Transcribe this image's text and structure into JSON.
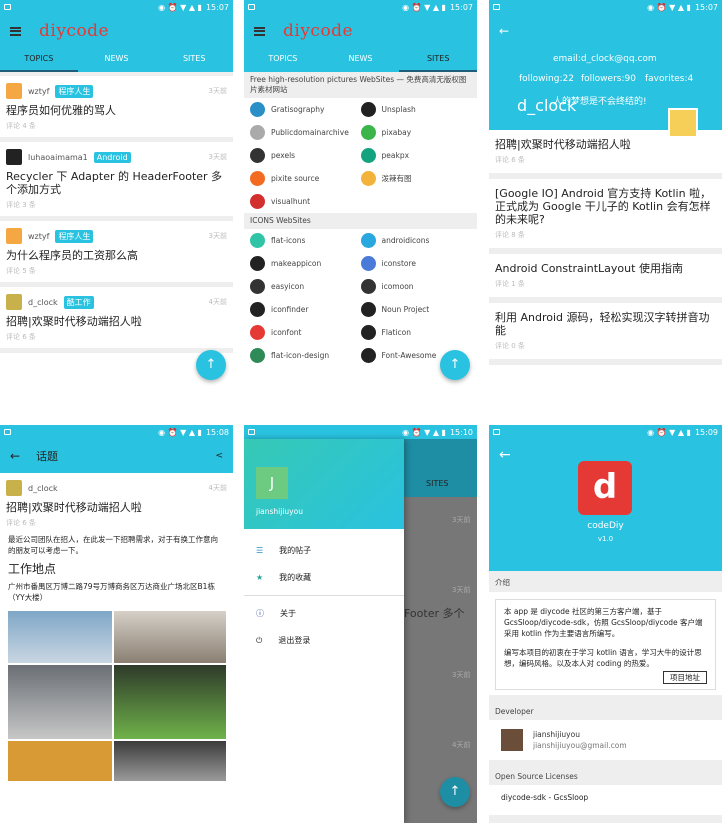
{
  "status": {
    "time1": "15:07",
    "time2": "15:07",
    "time3": "15:07",
    "time4": "15:08",
    "time5": "15:10",
    "time6": "15:09"
  },
  "home": {
    "logo": "diycode",
    "tabs": [
      "TOPICS",
      "NEWS",
      "SITES"
    ],
    "topics": [
      {
        "user": "wztyf",
        "badge": "程序人生",
        "time": "3天前",
        "title": "程序员如何优雅的骂人",
        "count": "评论 4 条"
      },
      {
        "user": "luhaoaimama1",
        "badge": "Android",
        "time": "3天前",
        "title": "Recycler 下 Adapter 的 HeaderFooter 多个添加方式",
        "count": "评论 3 条"
      },
      {
        "user": "wztyf",
        "badge": "程序人生",
        "time": "3天前",
        "title": "为什么程序员的工资那么高",
        "count": "评论 5 条"
      },
      {
        "user": "d_clock",
        "badge": "酷工作",
        "time": "4天前",
        "title": "招聘|欢聚时代移动端招人啦",
        "count": "评论 6 条"
      }
    ],
    "fab": "↑"
  },
  "sites": {
    "section1": "Free high-resolution pictures WebSites — 免费高清无版权图片素材网站",
    "group1": [
      {
        "name": "Gratisography",
        "icon": "cc",
        "color": "#2a8fc7"
      },
      {
        "name": "Unsplash",
        "icon": "cam",
        "color": "#222"
      },
      {
        "name": "Publicdomainarchive",
        "icon": "pd",
        "color": "#aaa"
      },
      {
        "name": "pixabay",
        "icon": "px",
        "color": "#3bb44a"
      },
      {
        "name": "pexels",
        "icon": "cam",
        "color": "#333"
      },
      {
        "name": "peakpx",
        "icon": "pk",
        "color": "#14a37f"
      },
      {
        "name": "pixite source",
        "icon": "fl",
        "color": "#f26b21"
      },
      {
        "name": "泼辣有图",
        "icon": "pl",
        "color": "#f3b23a"
      },
      {
        "name": "visualhunt",
        "icon": "v",
        "color": "#d32f2f"
      }
    ],
    "section2": "ICONS  WebSites",
    "group2": [
      {
        "name": "flat-icons",
        "icon": "F",
        "color": "#2ec4a5"
      },
      {
        "name": "androidicons",
        "icon": "a",
        "color": "#29a8e0"
      },
      {
        "name": "makeappicon",
        "icon": "★",
        "color": "#222"
      },
      {
        "name": "iconstore",
        "icon": "i",
        "color": "#4a7bd8"
      },
      {
        "name": "easyicon",
        "icon": "e",
        "color": "#333"
      },
      {
        "name": "icomoon",
        "icon": "◎",
        "color": "#333"
      },
      {
        "name": "iconfinder",
        "icon": "◉",
        "color": "#222"
      },
      {
        "name": "Noun Project",
        "icon": "nP",
        "color": "#222"
      },
      {
        "name": "iconfont",
        "icon": "☺",
        "color": "#e53935"
      },
      {
        "name": "Flaticon",
        "icon": "F",
        "color": "#222"
      },
      {
        "name": "flat-icon-design",
        "icon": "F",
        "color": "#2e8b57"
      },
      {
        "name": "Font-Awesome",
        "icon": "▶",
        "color": "#222"
      }
    ]
  },
  "user": {
    "email": "email:d_clock@qq.com",
    "following": "following:22",
    "followers": "followers:90",
    "favorites": "favorites:4",
    "motto": "人的梦想是不会终结的!",
    "name": "d_clock",
    "cards": [
      {
        "title": "招聘|欢聚时代移动端招人啦",
        "count": "评论 6 条"
      },
      {
        "title": "[Google IO] Android 官方支持 Kotlin 啦，正式成为 Google 干儿子的 Kotlin 会有怎样的未来呢?",
        "count": "评论 8 条"
      },
      {
        "title": "Android ConstraintLayout 使用指南",
        "count": "评论 1 条"
      },
      {
        "title": "利用 Android 源码，轻松实现汉字转拼音功能",
        "count": "评论 0 条"
      }
    ]
  },
  "topicdetail": {
    "bar_title": "话题",
    "user": "d_clock",
    "time": "4天前",
    "title": "招聘|欢聚时代移动端招人啦",
    "count": "评论 6 条",
    "para": "最近公司团队在招人，在此发一下招聘需求，对于有换工作意向的朋友可以考虑一下。",
    "h2": "工作地点",
    "addr": "广州市番禺区万博二路79号万博商务区万达商业广场北区B1栋（YY大楼）"
  },
  "drawer": {
    "avatar": "J",
    "name": "jianshijiuyou",
    "items": [
      "我的帖子",
      "我的收藏",
      "关于",
      "退出登录"
    ],
    "bg_tab": "SITES",
    "bg_times": [
      "3天前",
      "3天前",
      "3天前",
      "3天前",
      "4天前"
    ],
    "bg_text": "Footer 多个"
  },
  "about": {
    "app": "codeDiy",
    "version": "v1.0",
    "intro_title": "介绍",
    "intro1": "本 app 是 diycode 社区的第三方客户端，基于 GcsSloop/diycode-sdk，仿照 GcsSloop/diycode 客户端采用 kotlin 作为主要语言所编写。",
    "intro2": "编写本项目的初衷在于学习 kotlin 语言，学习大牛的设计思想，编码风格。以及本人对 coding 的热爱。",
    "project_btn": "项目地址",
    "dev_title": "Developer",
    "dev_name": "jianshijiuyou",
    "dev_email": "jianshijiuyou@gmail.com",
    "lic_title": "Open Source Licenses",
    "lic1": "diycode-sdk - GcsSloop"
  }
}
